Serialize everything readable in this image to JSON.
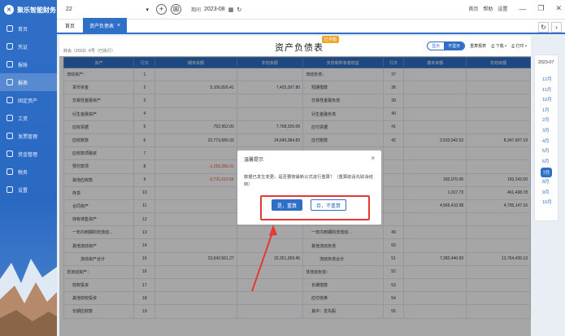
{
  "app": {
    "name": "聚乐智能财务"
  },
  "sidebar": {
    "items": [
      {
        "label": "首页"
      },
      {
        "label": "凭证"
      },
      {
        "label": "报账"
      },
      {
        "label": "报表"
      },
      {
        "label": "固定资产"
      },
      {
        "label": "工资"
      },
      {
        "label": "发票管理"
      },
      {
        "label": "资金管理"
      },
      {
        "label": "税务"
      },
      {
        "label": "设置"
      }
    ],
    "active": "报表"
  },
  "topbar": {
    "account": "22",
    "period_label": "期间",
    "period": "2023-08",
    "links": [
      "首页",
      "帮助",
      "设置"
    ]
  },
  "tabs": [
    {
      "label": "首页"
    },
    {
      "label": "资产负债表"
    }
  ],
  "report": {
    "title": "资产负债表",
    "badge": "已平衡",
    "meta": "财会（2019）6号（已执行）",
    "toolbar": {
      "opt1": "显示",
      "opt2": "不显示",
      "reclass": "重算报表",
      "download": "下载",
      "print": "打印"
    },
    "columns": [
      "资产",
      "行次",
      "期末余额",
      "年初余额",
      "负债和所有者权益",
      "行次",
      "期末余额",
      "年初余额"
    ],
    "rows": [
      [
        "流动资产：",
        "1",
        "",
        "",
        "流动负债：",
        "37",
        "",
        ""
      ],
      [
        "货币资金",
        "2",
        "5,106,826.41",
        "7,425,307.80",
        "短期借款",
        "38",
        "",
        ""
      ],
      [
        "交易性金融资产",
        "3",
        "",
        "",
        "交易性金融负债",
        "39",
        "",
        ""
      ],
      [
        "衍生金融资产",
        "4",
        "",
        "",
        "衍生金融负债",
        "40",
        "",
        ""
      ],
      [
        "应收票据",
        "5",
        "752,952.00",
        "7,768,326.09",
        "应付票据",
        "41",
        "",
        ""
      ],
      [
        "应收账款",
        "6",
        "22,773,680.33",
        "24,640,384.83",
        "应付账款",
        "42",
        "2,533,942.52",
        "8,347,607.19"
      ],
      [
        "应收款项融资",
        "7",
        "",
        "",
        "",
        "",
        "",
        ""
      ],
      [
        "预付款项",
        "8",
        "-1,259,286.01",
        "",
        "",
        "",
        "",
        ""
      ],
      [
        "其他应收款",
        "9",
        "-3,731,610.56",
        "",
        "",
        "",
        "182,070.00",
        "160,242.00"
      ],
      [
        "存货",
        "10",
        "",
        "",
        "",
        "",
        "1,017.73",
        "461,438.78"
      ],
      [
        "合同资产",
        "11",
        "",
        "",
        "",
        "",
        "4,565,410.58",
        "4,795,147.16"
      ],
      [
        "持有待售资产",
        "12",
        "",
        "",
        "",
        "",
        "",
        ""
      ],
      [
        "一年内到期的非流动...",
        "13",
        "",
        "",
        "一年内到期的非流动...",
        "49",
        "",
        ""
      ],
      [
        "其他流动资产",
        "14",
        "",
        "",
        "其他流动负债",
        "50",
        "",
        ""
      ],
      [
        "流动资产合计",
        "15",
        "23,642,561.27",
        "32,251,269.45",
        "流动负债合计",
        "51",
        "7,282,440.83",
        "13,764,435.13"
      ],
      [
        "非流动资产：",
        "16",
        "",
        "",
        "非流动负债：",
        "52",
        "",
        ""
      ],
      [
        "债权投资",
        "17",
        "",
        "",
        "长期借款",
        "53",
        "",
        ""
      ],
      [
        "其他债权投资",
        "18",
        "",
        "",
        "应付债券",
        "54",
        "",
        ""
      ],
      [
        "长期应收款",
        "19",
        "",
        "",
        "其中：优先股",
        "55",
        "",
        ""
      ]
    ]
  },
  "dialog": {
    "title": "温馨提示",
    "message": "数据已发生变更，是否要按最新公式进行重算？（重算前请先取消结转）",
    "confirm": "是，重算",
    "cancel": "否，不重算"
  },
  "datebar": {
    "year": "2023-07",
    "months": [
      "12月",
      "11月",
      "10月",
      "1月",
      "2月",
      "3月",
      "4月",
      "5月",
      "6月",
      "7月",
      "8月",
      "9月",
      "10月"
    ],
    "current": "7月"
  },
  "colors": {
    "primary": "#2f6fc7",
    "negative": "#e05a3a",
    "highlight": "#e53935"
  }
}
